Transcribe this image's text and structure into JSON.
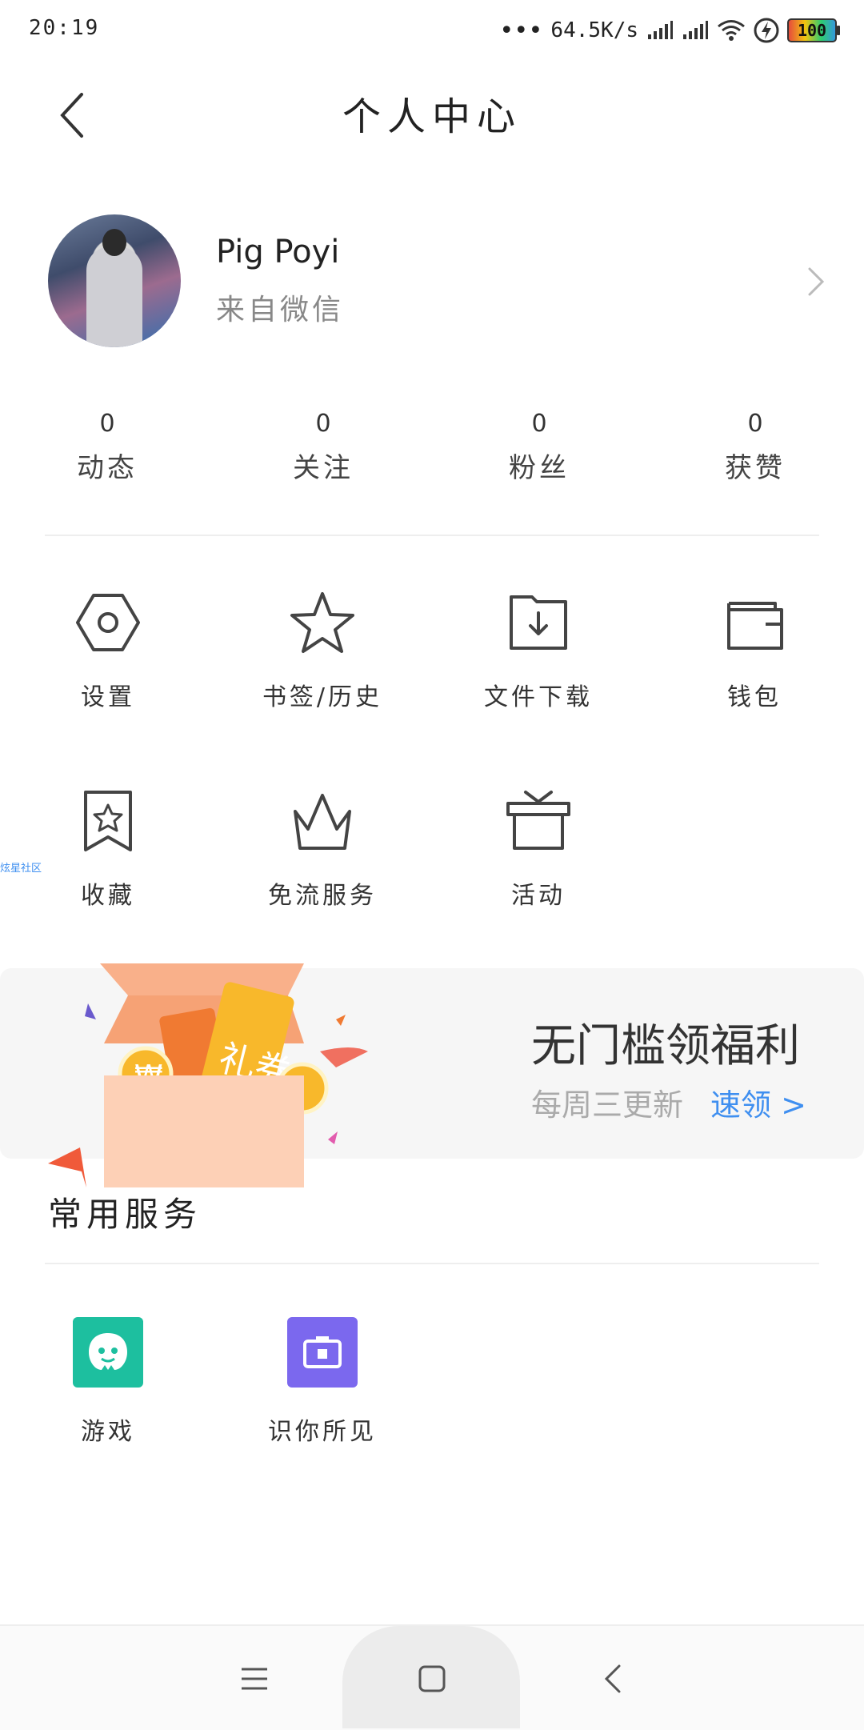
{
  "status_bar": {
    "time": "20:19",
    "net_speed": "64.5K/s",
    "battery": "100"
  },
  "header": {
    "title": "个人中心"
  },
  "profile": {
    "name": "Pig Poyi",
    "source": "来自微信"
  },
  "stats": [
    {
      "count": "0",
      "label": "动态"
    },
    {
      "count": "0",
      "label": "关注"
    },
    {
      "count": "0",
      "label": "粉丝"
    },
    {
      "count": "0",
      "label": "获赞"
    }
  ],
  "menu": [
    {
      "label": "设置",
      "icon": "settings-hexagon-icon"
    },
    {
      "label": "书签/历史",
      "icon": "star-icon"
    },
    {
      "label": "文件下载",
      "icon": "download-folder-icon"
    },
    {
      "label": "钱包",
      "icon": "wallet-icon"
    },
    {
      "label": "收藏",
      "icon": "bookmark-icon"
    },
    {
      "label": "免流服务",
      "icon": "crown-icon"
    },
    {
      "label": "活动",
      "icon": "gift-box-icon"
    }
  ],
  "side_tag": "炫星社区",
  "banner": {
    "title": "无门槛领福利",
    "subtitle": "每周三更新",
    "link": "速领 >",
    "ticket_text": "礼券"
  },
  "services": {
    "title": "常用服务",
    "items": [
      {
        "label": "游戏",
        "color": "#1dbf9f",
        "icon": "game-icon"
      },
      {
        "label": "识你所见",
        "color": "#7b68ee",
        "icon": "camera-icon"
      }
    ]
  },
  "colors": {
    "accent": "#3f8ff0",
    "game_tile": "#1dbf9f",
    "camera_tile": "#7b68ee"
  }
}
